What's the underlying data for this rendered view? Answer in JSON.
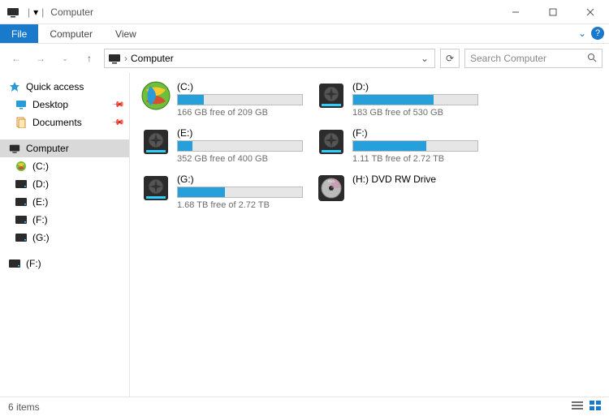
{
  "window": {
    "title": "Computer",
    "qat_dropdown": "▾"
  },
  "ribbon": {
    "file": "File",
    "tabs": [
      "Computer",
      "View"
    ]
  },
  "nav": {
    "breadcrumb": "Computer",
    "refresh_icon": "⟳",
    "search_placeholder": "Search Computer"
  },
  "sidebar": {
    "quick_access": {
      "label": "Quick access",
      "icon": "star-icon"
    },
    "quick_items": [
      {
        "label": "Desktop",
        "icon": "desktop-icon",
        "pinned": true
      },
      {
        "label": "Documents",
        "icon": "documents-icon",
        "pinned": true
      }
    ],
    "computer": {
      "label": "Computer",
      "icon": "computer-icon",
      "selected": true
    },
    "drives": [
      {
        "label": "(C:)",
        "icon": "windows-orb-icon"
      },
      {
        "label": "(D:)",
        "icon": "drive-icon"
      },
      {
        "label": "(E:)",
        "icon": "drive-icon"
      },
      {
        "label": "(F:)",
        "icon": "drive-icon"
      },
      {
        "label": "(G:)",
        "icon": "drive-icon"
      }
    ],
    "extra": [
      {
        "label": "(F:)",
        "icon": "drive-icon"
      }
    ]
  },
  "drives": [
    {
      "label": "(C:)",
      "free_text": "166 GB free of 209 GB",
      "used_pct": 21,
      "icon": "windows-orb-icon"
    },
    {
      "label": "(D:)",
      "free_text": "183 GB free of 530 GB",
      "used_pct": 65,
      "icon": "hdd-icon"
    },
    {
      "label": "(E:)",
      "free_text": "352 GB free of 400 GB",
      "used_pct": 12,
      "icon": "hdd-icon"
    },
    {
      "label": "(F:)",
      "free_text": "1.11 TB free of 2.72 TB",
      "used_pct": 59,
      "icon": "hdd-icon"
    },
    {
      "label": "(G:)",
      "free_text": "1.68 TB free of 2.72 TB",
      "used_pct": 38,
      "icon": "hdd-icon"
    },
    {
      "label": "(H:) DVD RW Drive",
      "free_text": "",
      "used_pct": null,
      "icon": "dvd-icon"
    }
  ],
  "status": {
    "text": "6 items"
  }
}
